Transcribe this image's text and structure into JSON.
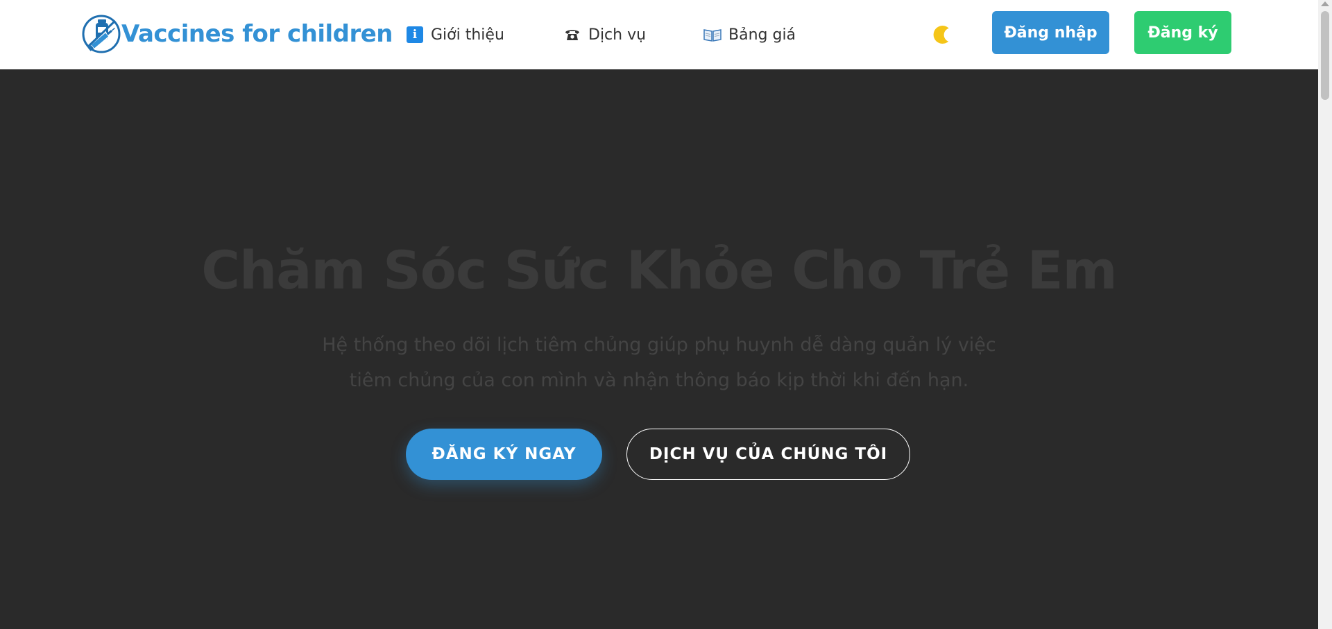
{
  "header": {
    "logo_text": "Vaccines for children",
    "nav": [
      {
        "label": "Giới thiệu",
        "icon": "info-icon"
      },
      {
        "label": "Dịch vụ",
        "icon": "telephone-icon"
      },
      {
        "label": "Bảng giá",
        "icon": "book-icon"
      }
    ],
    "theme_toggle_icon": "moon-icon",
    "login_label": "Đăng nhập",
    "register_label": "Đăng ký"
  },
  "hero": {
    "title": "Chăm Sóc Sức Khỏe Cho Trẻ Em",
    "subtitle": "Hệ thống theo dõi lịch tiêm chủng giúp phụ huynh dễ dàng quản lý việc tiêm chủng của con mình và nhận thông báo kịp thời khi đến hạn.",
    "primary_cta": "ĐĂNG KÝ NGAY",
    "secondary_cta": "DỊCH VỤ CỦA CHÚNG TÔI"
  },
  "colors": {
    "brand_blue": "#3391d5",
    "register_green": "#2ecc71",
    "hero_background": "#2a2a2a",
    "header_background": "#ffffff"
  }
}
